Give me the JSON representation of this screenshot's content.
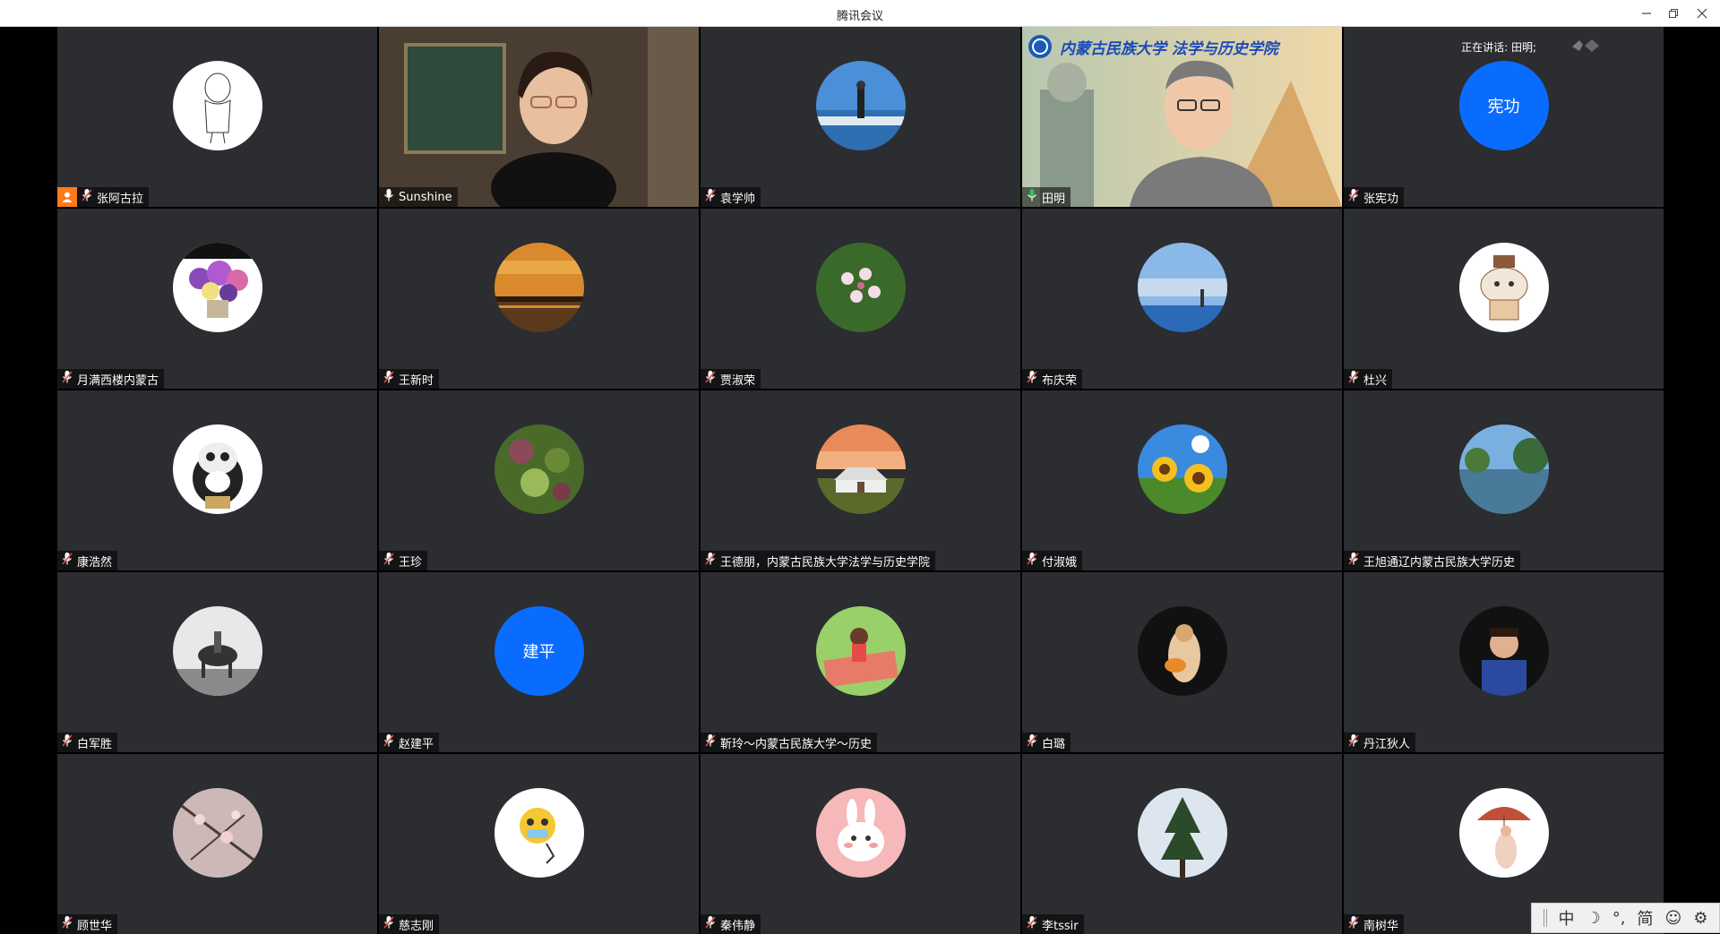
{
  "window": {
    "title": "腾讯会议"
  },
  "speaking": {
    "label": "正在讲话: 田明;"
  },
  "ime": {
    "mode": "中",
    "moon": "☽",
    "punct": "°,",
    "simp": "简",
    "emoji": "☺",
    "gear": "⚙"
  },
  "participants": [
    {
      "name": "张阿古拉",
      "type": "avatar",
      "host": true,
      "art": "sketch"
    },
    {
      "name": "Sunshine",
      "type": "video",
      "art": "woman"
    },
    {
      "name": "袁学帅",
      "type": "avatar",
      "art": "sea"
    },
    {
      "name": "田明",
      "type": "video",
      "speaking": true,
      "art": "man",
      "banner": "内蒙古民族大学 法学与历史学院"
    },
    {
      "name": "张宪功",
      "type": "initials",
      "initials": "宪功"
    },
    {
      "name": "月满西楼内蒙古",
      "type": "avatar",
      "art": "flowers"
    },
    {
      "name": "王新时",
      "type": "avatar",
      "art": "sunset"
    },
    {
      "name": "贾淑荣",
      "type": "avatar",
      "art": "blossom"
    },
    {
      "name": "布庆荣",
      "type": "avatar",
      "art": "sky"
    },
    {
      "name": "杜兴",
      "type": "avatar",
      "art": "cat"
    },
    {
      "name": "康浩然",
      "type": "avatar",
      "art": "panda"
    },
    {
      "name": "王珍",
      "type": "avatar",
      "art": "leaves"
    },
    {
      "name": "王德朋，内蒙古民族大学法学与历史学院",
      "type": "avatar",
      "art": "yurt"
    },
    {
      "name": "付淑娥",
      "type": "avatar",
      "art": "sunflower"
    },
    {
      "name": "王旭通辽内蒙古民族大学历史",
      "type": "avatar",
      "art": "lake"
    },
    {
      "name": "白军胜",
      "type": "avatar",
      "art": "horse"
    },
    {
      "name": "赵建平",
      "type": "initials",
      "initials": "建平"
    },
    {
      "name": "靳玲～内蒙古民族大学～历史",
      "type": "avatar",
      "art": "girl"
    },
    {
      "name": "白璐",
      "type": "avatar",
      "art": "dancer"
    },
    {
      "name": "丹江狄人",
      "type": "avatar",
      "art": "portrait"
    },
    {
      "name": "顾世华",
      "type": "avatar",
      "art": "cherry"
    },
    {
      "name": "慈志刚",
      "type": "avatar",
      "art": "emoji"
    },
    {
      "name": "秦伟静",
      "type": "avatar",
      "art": "rabbit"
    },
    {
      "name": "李tssir",
      "type": "avatar",
      "art": "tree"
    },
    {
      "name": "南树华",
      "type": "avatar",
      "art": "umbrella"
    }
  ],
  "colors": {
    "tile": "#2b2d30",
    "accent": "#0a6cff",
    "speaking": "#2fbf5b",
    "host": "#ff7a1a",
    "micMuted": "#e04848"
  }
}
